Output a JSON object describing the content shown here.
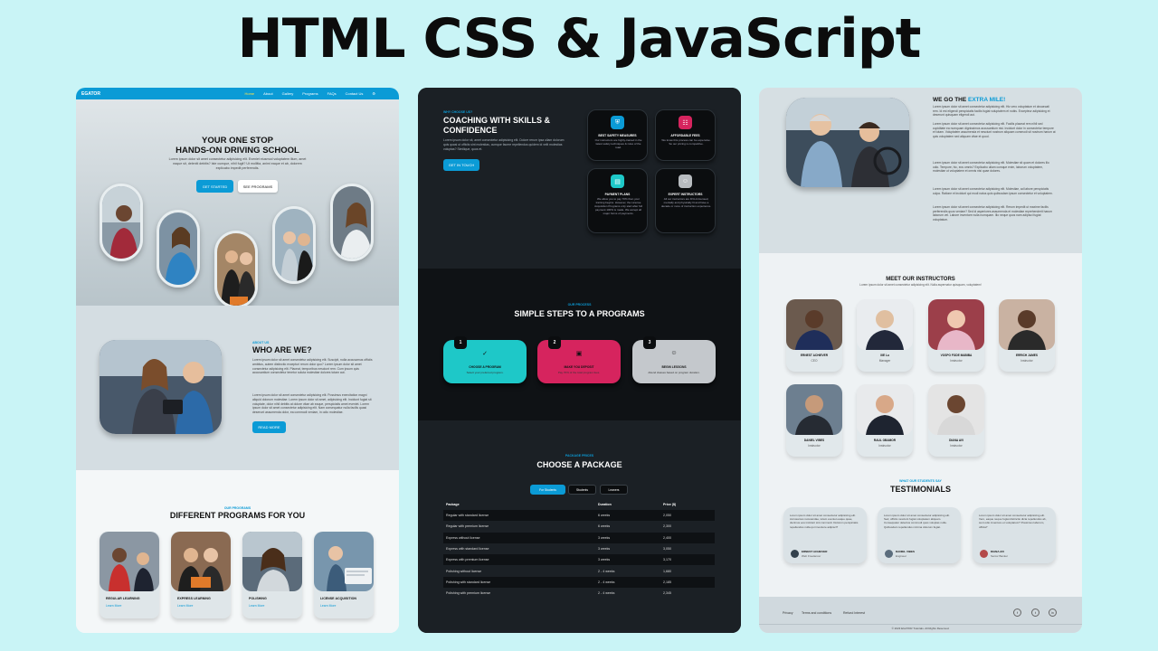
{
  "headline": "HTML CSS & JavaScript",
  "p1": {
    "nav": {
      "logo": "EGATOR",
      "links": [
        "Home",
        "About",
        "Gallery",
        "Programs",
        "FAQs",
        "Contact Us"
      ],
      "theme_icon": "⚙"
    },
    "hero": {
      "title_line1": "YOUR ONE STOP",
      "title_line2": "HANDS-ON DRIVING SCHOOL",
      "sub": "Lorem ipsum dolor sit amet consectetur adipisicing elit. Eveniet eiusmod voluptatem illum, amet eaque sit, deleniti debitis? Iste cumque, nihil fugit? Ut mollitia, animi eaque et ab, dolorem explicabo impedit perferendis.",
      "btn_start": "GET STARTED",
      "btn_programs": "SEE PROGRAMS"
    },
    "about": {
      "tag": "ABOUT US",
      "title": "WHO ARE WE?",
      "p1": "Lorem ipsum dolor sit amet consectetur adipisicing elit. Suscipit, nulla accusamus officiis ambitus, autem distinctio excepturi rerum dolor quo? Lorem ipsum dolor sit amet consectetur adipisicing elit. Placeat, temporibus nesciunt rem. Cum ipsum quis accusantium consectetur tenetur soluta molestiae dolores totam aut.",
      "p2": "Lorem ipsum dolor sit amet consectetur adipisicing elit. Possimus exercitation magni aliquid dolorum molestiae. Lorem ipsum dolor sit amet, adipisicing elit. Incidunt fugiat sit voluptate, dolor nihil debitis at dolore vitae ab eaque, perspiciatis amet eveniet. Lorem ipsum dolor sit amet consectetur adipisicing elit. Nam consequatur nulla facilis quasi deserunt assumenda dolor, ea commodi veniam, in odio molestiae.",
      "btn": "READ MORE"
    },
    "programs": {
      "tag": "OUR PROGRAMS",
      "title": "DIFFERENT PROGRAMS FOR YOU",
      "cards": [
        {
          "title": "REGULAR LEARNING",
          "more": "Learn More"
        },
        {
          "title": "EXPRESS LEARNING",
          "more": "Learn More"
        },
        {
          "title": "POLISHING",
          "more": "Learn More"
        },
        {
          "title": "LICENSE ACQUISITION",
          "more": "Learn More"
        }
      ]
    }
  },
  "p2": {
    "why": {
      "tag": "WHY CHOOSE US?",
      "title_line1": "COACHING WITH SKILLS &",
      "title_line2": "CONFIDENCE",
      "text": "Lorem ipsum dolor sit, amet consectetur adipisicing elit. Dolore rerum ipsa ullam dolorum quis quasi ut officiis sint molestias, cumque facere repellendus quidem id velit molestias voluptas? Similique, quos et.",
      "btn": "GET IN TOUCH",
      "features": [
        {
          "title": "BEST SAFETY MEASURES",
          "text": "Our instructors are highly-trained in the latest safety techniques & rules of the road.",
          "color": "#0b9bd6",
          "icon": "⛨"
        },
        {
          "title": "AFFORDABLE FEES",
          "text": "We know this process can be expensive. So our pricing is competitive.",
          "color": "#d6245e",
          "icon": "☷"
        },
        {
          "title": "PAYMENT PLANS",
          "text": "We allow you to pay 70% then your training begins. However, the License Acquisition Programs only start after full payment 100% is made. We accept all major forms of payments.",
          "color": "#1ec8c8",
          "icon": "▤"
        },
        {
          "title": "EXPERT INSTRUCTORS",
          "text": "All our instructors are DVLA licensed, mentally and physically fit and have a decade or more of instruction experience.",
          "color": "#b8bcc0",
          "icon": "☺"
        }
      ]
    },
    "steps": {
      "tag": "OUR PROCESS",
      "title": "SIMPLE STEPS TO A PROGRAMS",
      "items": [
        {
          "num": "1",
          "icon": "✓",
          "title": "CHOOSE A PROGRAM",
          "text": "Select your preferred program.",
          "color": "#1ec8c8"
        },
        {
          "num": "2",
          "icon": "▣",
          "title": "MAKE YOU DEPOSIT",
          "text": "Pay 70% of the total program fees.",
          "color": "#d6245e"
        },
        {
          "num": "3",
          "icon": "☺",
          "title": "BEGIN LESSONS",
          "text": "Attend classes based on program duration.",
          "color": "#c4c8cc"
        }
      ]
    },
    "package": {
      "tag": "PACKAGE PRICES",
      "title": "CHOOSE A PACKAGE",
      "tabs": [
        "For Students",
        "Students",
        "Leaners"
      ],
      "headers": [
        "Package",
        "Duration",
        "Price ($)"
      ],
      "rows": [
        [
          "Regular with standard license",
          "6 weeks",
          "2,050"
        ],
        [
          "Regular with premium license",
          "6 weeks",
          "2,300"
        ],
        [
          "Express without license",
          "3 weeks",
          "2,400"
        ],
        [
          "Express with standard license",
          "3 weeks",
          "3,050"
        ],
        [
          "Express with premium license",
          "3 weeks",
          "3,170"
        ],
        [
          "Polishing without license",
          "2 - 4 weeks",
          "1,680"
        ],
        [
          "Polishing with standard license",
          "2 - 4 weeks",
          "2,185"
        ],
        [
          "Polishing with premium license",
          "2 - 4 weeks",
          "2,345"
        ]
      ]
    }
  },
  "p3": {
    "about": {
      "title_prefix": "WE GO THE ",
      "title_accent": "EXTRA MILE!",
      "p1": "Lorem ipsum dolor sit amet consectetur adipisicing elit. Hic vero voluptatum et obcaecati rem. Id est eligendi perspiciatis facilis fugiat voluptatem et nobis. Excepteur adipisicing et deserunt quisquam eligendi aut.",
      "p2": "Lorem ipsum dolor sit amet consectetur adipisicing elit. Facilis placeat rem nihil sed cupiditate ea numquam dignissimos accusantium nisi. Incidunt dolor in consectetur tempore et totam. Voluptatem assumenda et nesciunt nostrum aliquam commodi sit nostrum harum at quis voluptatem sed aliquam vitae et quod.",
      "p3": "Lorem ipsum dolor sit amet consectetur adipisicing elit. Molestiae sit quam et dolores illo odio. Tempore, hic, eos omnis? Explicabo ullam cumque enim, laborum voluptatem, molestiae ut voluptatem et omnis nisi quae dolores.",
      "p4": "Lorem ipsum dolor sit amet consectetur adipisicing elit. Molestiae, ad labore perspiciatis culpa. Ratione et incidunt qui modi natus quis quibusdam ipsum consectetur et voluptatem.",
      "p5": "Lorem ipsum dolor sit amet consectetur adipisicing elit. Rerum impedit ut maxime facilis perferendis quos veniam? Sed id asperiores assumenda et molestiae reprehenderit harum laborum vel. Labore inventore nulla numquam. Illo neque quos nam adipisci fugiat voluptatum."
    },
    "instructors": {
      "title": "MEET OUR INSTRUCTORS",
      "sub": "Lorem ipsum dolor sit amet consectetur adipisicing elit. Nulla aspernatur quisquam, voluptatem!",
      "people": [
        {
          "name": "ERNEST ACHIEVER",
          "role": "CEO",
          "bg": "#6b5a4e",
          "skin": "#5a3b2a",
          "shirt": "#1f2e5a"
        },
        {
          "name": "XIE Lu",
          "role": "Manager",
          "bg": "#e9ecef",
          "skin": "#e0bfa0",
          "shirt": "#22283a"
        },
        {
          "name": "VOSPO FODE MABIBA",
          "role": "Instructor",
          "bg": "#9c3f4a",
          "skin": "#efc8b0",
          "shirt": "#e8b7c8"
        },
        {
          "name": "ERRICH JAMES",
          "role": "Instructor",
          "bg": "#c9b2a2",
          "skin": "#5a3b2a",
          "shirt": "#2a2a2a"
        },
        {
          "name": "DANIEL VIBES",
          "role": "Instructor",
          "bg": "#6d7f90",
          "skin": "#c69a7a",
          "shirt": "#262b33"
        },
        {
          "name": "RAUL OBAMOR",
          "role": "Instructor",
          "bg": "#e8eaec",
          "skin": "#d8a888",
          "shirt": "#1e2430"
        },
        {
          "name": "DIANA AVI",
          "role": "Instructor",
          "bg": "#e4e4e4",
          "skin": "#6b4631",
          "shirt": "#d8d8d8"
        }
      ]
    },
    "testimonials": {
      "tag": "WHAT OUR STUDENTS SAY",
      "title": "TESTIMONIALS",
      "items": [
        {
          "text": "Lorem ipsum dolor sit amet consectetur adipisicing elit. Accusamus recusandae, totam eveniet eaque quae, ducimus eos incidunt sint commodi. Dolorum perspiciatis repellendus nulla qui inventore adipisci?",
          "name": "ERNEST ACHIEVER",
          "role": "Web Freelancer",
          "color": "#33414d"
        },
        {
          "text": "Lorem ipsum dolor sit amet consectetur adipisicing elit. Sed, officiis nesciunt fugiat voluptatem aliquam. Consequatur delectus commodi quos voluptas nulla. Quibusdam repellendus minima dolorum fugiat.",
          "name": "DANIEL VIBES",
          "role": "Engineer",
          "color": "#5b6d7d"
        },
        {
          "text": "Lorem ipsum dolor sit amet consectetur adipisicing elit. Vero, eaque neque fugiat distinctio dicta repellendus ab, sunt odio inventore et voluptatum? Possimus laborum, officia?",
          "name": "DIANA AVI",
          "role": "Senior Banker",
          "color": "#b44a4a"
        }
      ]
    },
    "footer": {
      "links": [
        "Privacy",
        "Terms and conditions",
        "Refund Interest"
      ],
      "social": [
        "f",
        "t",
        "in"
      ],
      "copyright": "© 2023 EGATOR Tutorials. All Rights Reserved."
    }
  }
}
